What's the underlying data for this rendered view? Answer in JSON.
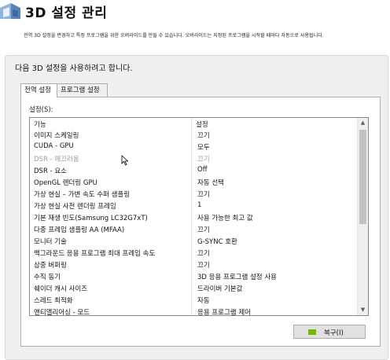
{
  "header": {
    "title": "3D 설정 관리",
    "description": "전역 3D 설정을 변경하고 특정 프로그램을 위한 오버라이드를 만들 수 있습니다. 오버라이드는 지정된 프로그램을 시작할 때마다 자동으로 사용됩니다."
  },
  "panel": {
    "heading": "다음 3D 설정을 사용하려고 합니다.",
    "tabs": [
      {
        "label": "전역 설정",
        "active": true
      },
      {
        "label": "프로그램 설정",
        "active": false
      }
    ],
    "settings_label": "설정(S):",
    "columns": [
      "기능",
      "설정"
    ],
    "rows": [
      {
        "feature": "이미지 스케일링",
        "value": "끄기",
        "disabled": false
      },
      {
        "feature": "CUDA - GPU",
        "value": "모두",
        "disabled": false
      },
      {
        "feature": "DSR - 매끄러움",
        "value": "끄기",
        "disabled": true
      },
      {
        "feature": "DSR - 요소",
        "value": "Off",
        "disabled": false
      },
      {
        "feature": "OpenGL 렌더링 GPU",
        "value": "자동 선택",
        "disabled": false
      },
      {
        "feature": "가상 현실 – 가변 속도 수퍼 샘플링",
        "value": "끄기",
        "disabled": false
      },
      {
        "feature": "가상 현실 사전 렌더링 프레임",
        "value": "1",
        "disabled": false
      },
      {
        "feature": "기본 재생 빈도(Samsung LC32G7xT)",
        "value": "사용 가능한 최고 값",
        "disabled": false
      },
      {
        "feature": "다중 프레임 샘플링 AA (MFAA)",
        "value": "끄기",
        "disabled": false
      },
      {
        "feature": "모니터 기술",
        "value": "G-SYNC 호환",
        "disabled": false
      },
      {
        "feature": "백그라운드 응용 프로그램 최대 프레임 속도",
        "value": "끄기",
        "disabled": false
      },
      {
        "feature": "삼중 버퍼링",
        "value": "끄기",
        "disabled": false
      },
      {
        "feature": "수직 동기",
        "value": "3D 응용 프로그램 설정 사용",
        "disabled": false
      },
      {
        "feature": "쉐이더 캐시 사이즈",
        "value": "드라이버 기본값",
        "disabled": false
      },
      {
        "feature": "스레드 최적화",
        "value": "자동",
        "disabled": false
      },
      {
        "feature": "앤티앨리어싱 - 모드",
        "value": "응용 프로그램 제어",
        "disabled": false
      }
    ],
    "scroll_up_glyph": "▲",
    "scroll_down_glyph": "▼",
    "restore_button": "복구(I)"
  },
  "colors": {
    "accent_icon": "#76b900",
    "disabled_text": "#9a9a9a"
  },
  "icons": {
    "logo": "3d-cube-logo-icon",
    "restore": "nvidia-restore-icon",
    "cursor": "mouse-cursor-icon"
  }
}
